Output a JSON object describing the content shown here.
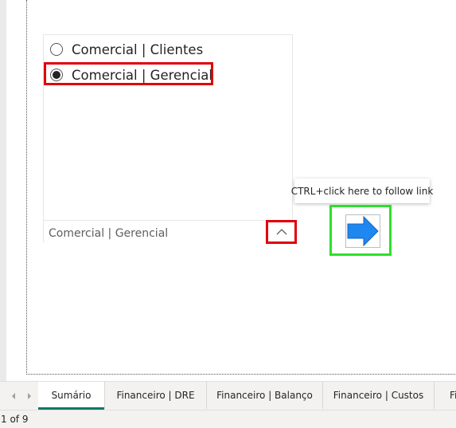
{
  "slicer": {
    "options": [
      {
        "label": "Comercial | Clientes",
        "selected": false
      },
      {
        "label": "Comercial | Gerencial",
        "selected": true
      }
    ],
    "selected_value": "Comercial | Gerencial"
  },
  "tooltip": {
    "text": "CTRL+click here to follow link"
  },
  "arrow_button": {
    "icon": "right-arrow-icon",
    "color": "#1e87f0"
  },
  "highlight_colors": {
    "red": "#e0000b",
    "green": "#2ddf2d"
  },
  "tabs": [
    {
      "label": "Sumário",
      "active": true
    },
    {
      "label": "Financeiro | DRE",
      "active": false
    },
    {
      "label": "Financeiro | Balanço",
      "active": false
    },
    {
      "label": "Financeiro | Custos",
      "active": false
    },
    {
      "label": "Fi",
      "active": false
    }
  ],
  "accent_color": "#117865",
  "status": {
    "page_counter": "1 of 9"
  }
}
